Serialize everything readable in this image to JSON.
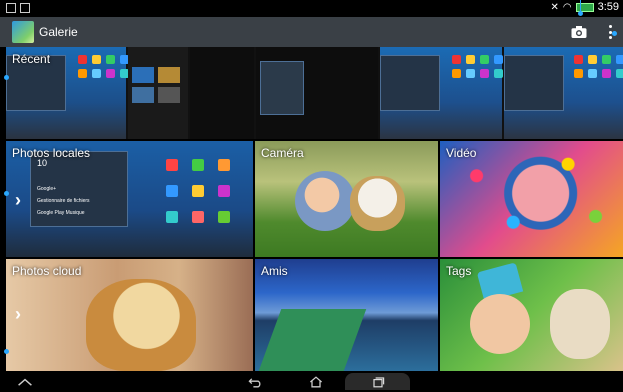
{
  "app": {
    "title": "Galerie"
  },
  "status": {
    "time": "3:59"
  },
  "sections": {
    "recent": "Récent",
    "local_photos": "Photos locales",
    "camera": "Caméra",
    "video": "Vidéo",
    "cloud_photos": "Photos cloud",
    "friends": "Amis",
    "tags": "Tags"
  },
  "local_thumb": {
    "apps": [
      "Google+",
      "Gestionnaire de fichiers",
      "Google Play Musique"
    ],
    "big_number": "10"
  },
  "icons": {
    "camera": "camera-icon",
    "more": "overflow-menu-icon",
    "expand": "chevron-right-icon",
    "nav_up": "chevron-up-icon",
    "nav_back": "back-icon",
    "nav_home": "home-icon",
    "nav_recent": "recent-apps-icon"
  },
  "colors": {
    "appbar": "#3a4046",
    "accent": "#2aa8ff",
    "battery": "#2ea84a"
  }
}
